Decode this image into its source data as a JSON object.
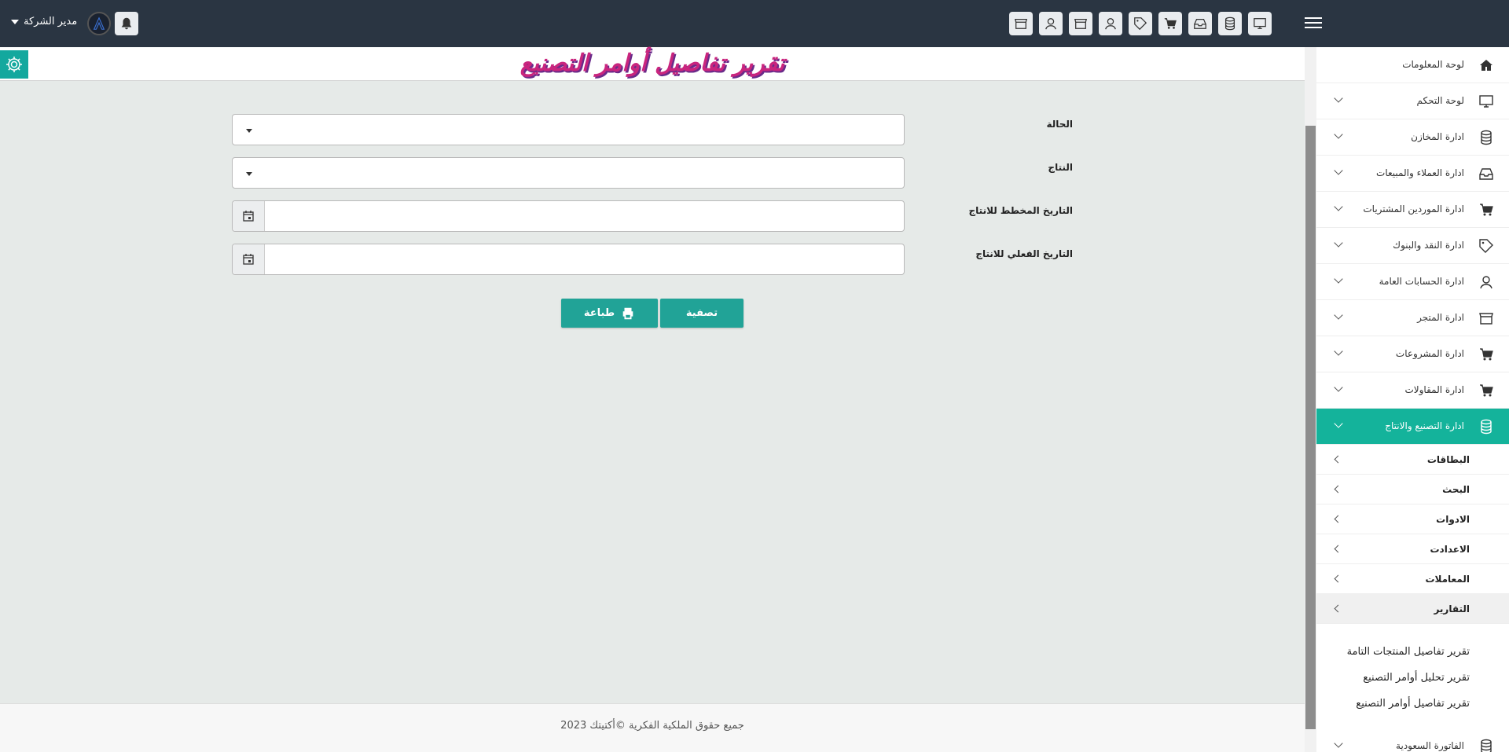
{
  "topbar": {
    "user_name": "مدير الشركة",
    "icons": [
      "monitor-icon",
      "database-icon",
      "inbox-icon",
      "cart-icon",
      "tag-icon",
      "user-icon",
      "store-icon",
      "user-icon",
      "store-icon"
    ]
  },
  "page": {
    "title": "تقرير تفاصيل أوامر التصنيع"
  },
  "form": {
    "status_label": "الحالة",
    "product_label": "النتاج",
    "planned_date_label": "التاريخ المخطط للانتاج",
    "actual_date_label": "التاريخ الفعلي للانتاج",
    "status_value": "",
    "product_value": "",
    "planned_date_value": "",
    "actual_date_value": ""
  },
  "buttons": {
    "filter_label": "تصفية",
    "print_label": "طباعة"
  },
  "footer": {
    "text": "جميع حقوق الملكية الفكرية ©أكتيتك 2023"
  },
  "sidebar": {
    "items": [
      {
        "label": "لوحة المعلومات",
        "icon": "home-icon"
      },
      {
        "label": "لوحة التحكم",
        "icon": "monitor-icon"
      },
      {
        "label": "ادارة المخازن",
        "icon": "database-icon"
      },
      {
        "label": "ادارة العملاء والمبيعات",
        "icon": "inbox-icon"
      },
      {
        "label": "ادارة الموردين المشتريات",
        "icon": "cart-icon"
      },
      {
        "label": "ادارة النقد والبنوك",
        "icon": "tag-icon"
      },
      {
        "label": "ادارة الحسابات العامة",
        "icon": "user-icon"
      },
      {
        "label": "ادارة المتجر",
        "icon": "store-icon"
      },
      {
        "label": "ادارة المشروعات",
        "icon": "cart-icon"
      },
      {
        "label": "ادارة المقاولات",
        "icon": "cart-icon"
      },
      {
        "label": "ادارة التصنيع والانتاج",
        "icon": "database-icon"
      }
    ],
    "sub_items": [
      {
        "label": "البطاقات"
      },
      {
        "label": "البحث"
      },
      {
        "label": "الادوات"
      },
      {
        "label": "الاعدادت"
      },
      {
        "label": "المعاملات"
      },
      {
        "label": "التقارير"
      }
    ],
    "reports": [
      {
        "label": "تقرير تفاصيل المنتجات التامة"
      },
      {
        "label": "تقرير تحليل أوامر التصنيع"
      },
      {
        "label": "تقرير تفاصيل أوامر التصنيع"
      }
    ],
    "last_item": {
      "label": "الفاتورة السعودية",
      "icon": "database-icon"
    },
    "accent": "#14b39b"
  }
}
